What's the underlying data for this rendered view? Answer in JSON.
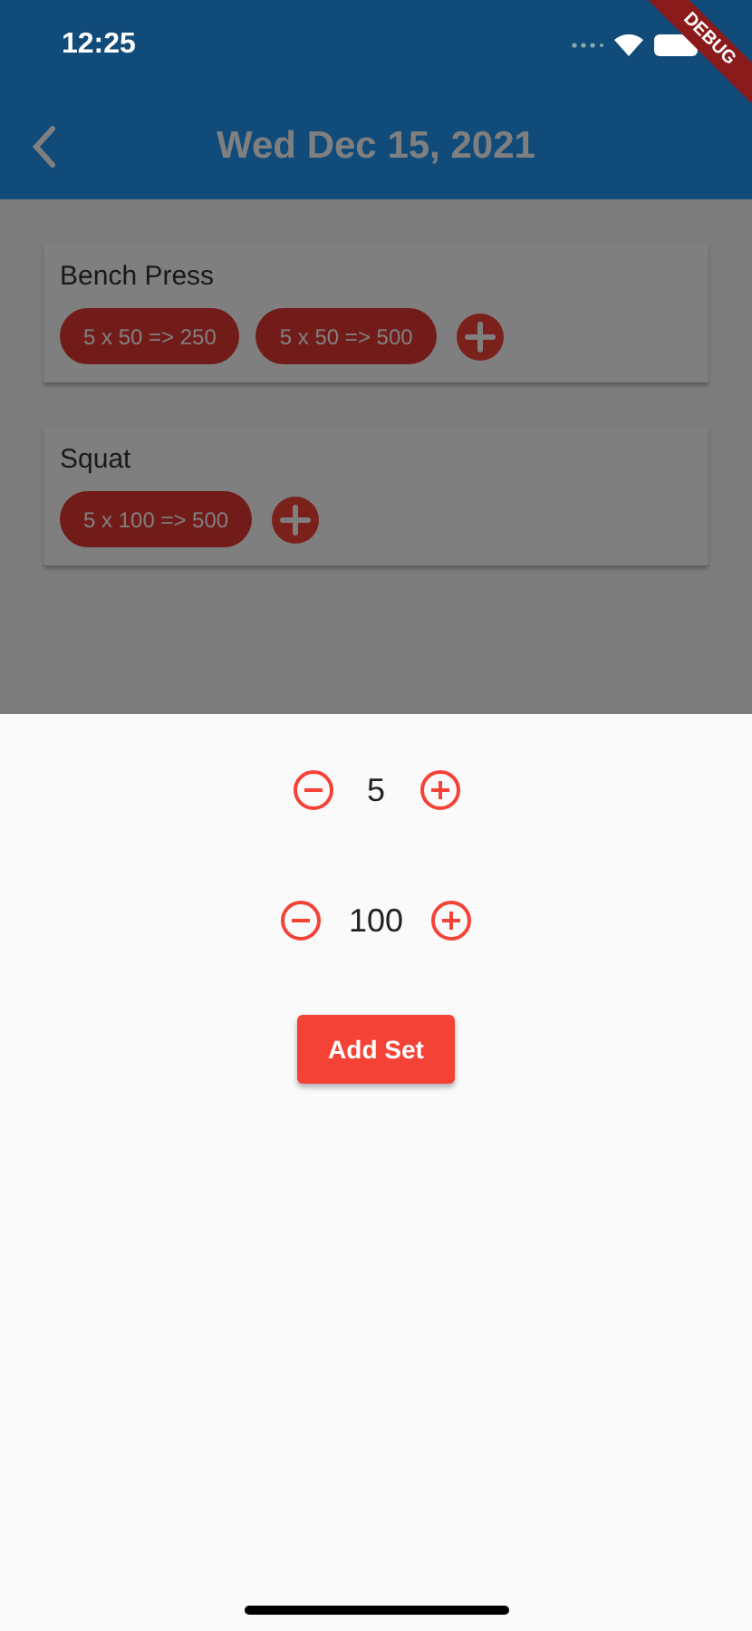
{
  "status_bar": {
    "time": "12:25"
  },
  "debug_banner": "DEBUG",
  "app_bar": {
    "title": "Wed Dec 15, 2021"
  },
  "exercises": [
    {
      "name": "Bench Press",
      "sets": [
        "5 x 50 => 250",
        "5 x 50 => 500"
      ]
    },
    {
      "name": "Squat",
      "sets": [
        "5 x 100 => 500"
      ]
    }
  ],
  "sheet": {
    "counters": [
      {
        "value": "5"
      },
      {
        "value": "100"
      }
    ],
    "button": "Add Set"
  }
}
